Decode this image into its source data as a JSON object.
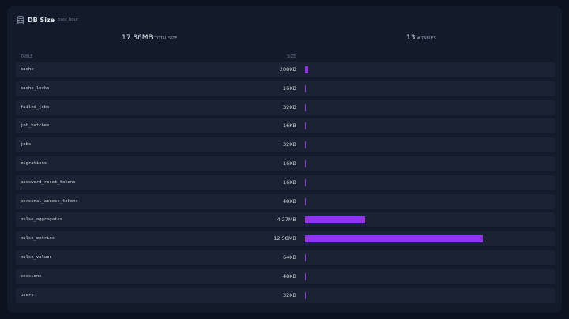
{
  "header": {
    "title": "DB Size",
    "period": "past hour"
  },
  "summary": {
    "total_size_value": "17.36MB",
    "total_size_label": "TOTAL SIZE",
    "tables_value": "13",
    "tables_label": "# TABLES"
  },
  "columns": {
    "table": "TABLE",
    "size": "SIZE"
  },
  "colors": {
    "bar": "#9333ea",
    "row_bg": "#1a2233",
    "card_bg": "#131a29"
  },
  "rows": [
    {
      "name": "cache",
      "size": "208KB",
      "bytes_kb": 208
    },
    {
      "name": "cache_locks",
      "size": "16KB",
      "bytes_kb": 16
    },
    {
      "name": "failed_jobs",
      "size": "32KB",
      "bytes_kb": 32
    },
    {
      "name": "job_batches",
      "size": "16KB",
      "bytes_kb": 16
    },
    {
      "name": "jobs",
      "size": "32KB",
      "bytes_kb": 32
    },
    {
      "name": "migrations",
      "size": "16KB",
      "bytes_kb": 16
    },
    {
      "name": "password_reset_tokens",
      "size": "16KB",
      "bytes_kb": 16
    },
    {
      "name": "personal_access_tokens",
      "size": "48KB",
      "bytes_kb": 48
    },
    {
      "name": "pulse_aggregates",
      "size": "4.27MB",
      "bytes_kb": 4372
    },
    {
      "name": "pulse_entries",
      "size": "12.58MB",
      "bytes_kb": 12882
    },
    {
      "name": "pulse_values",
      "size": "64KB",
      "bytes_kb": 64
    },
    {
      "name": "sessions",
      "size": "48KB",
      "bytes_kb": 48
    },
    {
      "name": "users",
      "size": "32KB",
      "bytes_kb": 32
    }
  ]
}
